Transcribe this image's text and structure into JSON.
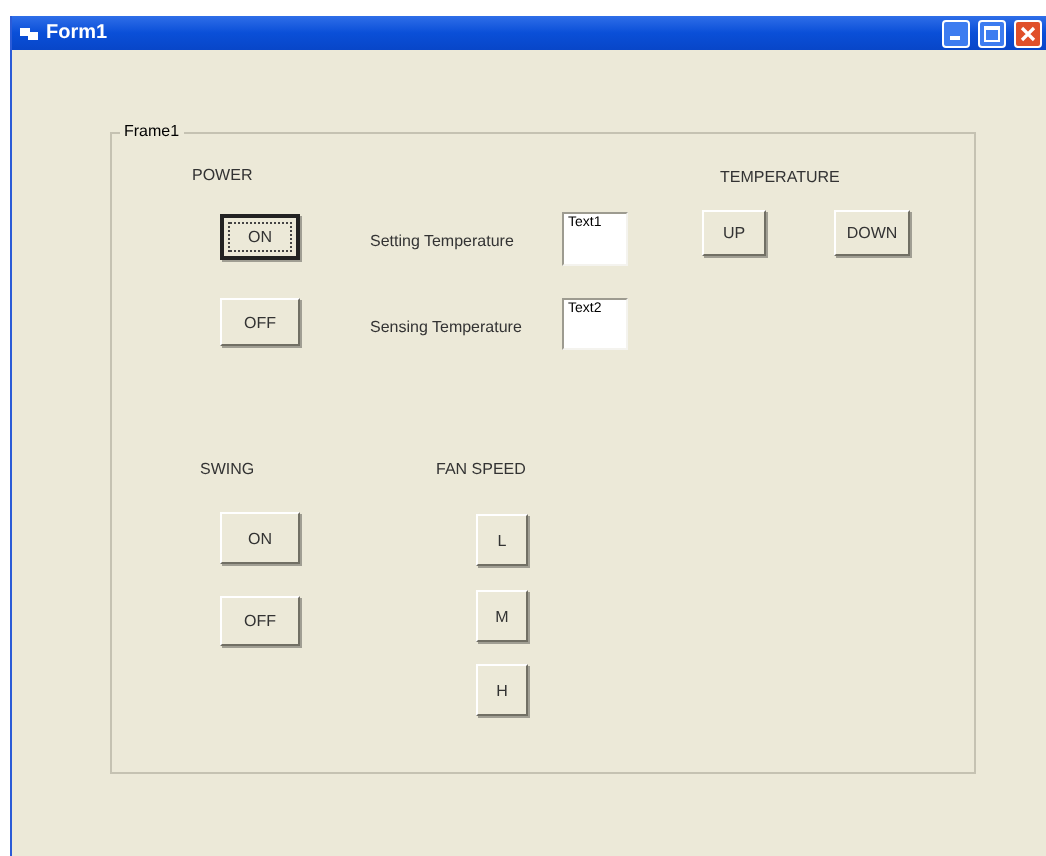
{
  "window": {
    "title": "Form1"
  },
  "frame": {
    "title": "Frame1"
  },
  "power": {
    "label": "POWER",
    "buttons": [
      {
        "label": "ON",
        "focused": true
      },
      {
        "label": "OFF",
        "focused": false
      }
    ]
  },
  "fields": [
    {
      "label": "Setting Temperature",
      "value": "Text1"
    },
    {
      "label": "Sensing Temperature",
      "value": "Text2"
    }
  ],
  "temperature": {
    "label": "TEMPERATURE",
    "buttons": [
      {
        "label": "UP",
        "focused": false
      },
      {
        "label": "DOWN",
        "focused": false
      }
    ]
  },
  "swing": {
    "label": "SWING",
    "buttons": [
      {
        "label": "ON",
        "focused": false
      },
      {
        "label": "OFF",
        "focused": false
      }
    ]
  },
  "fan_speed": {
    "label": "FAN SPEED",
    "buttons": [
      {
        "label": "L",
        "focused": false
      },
      {
        "label": "M",
        "focused": false
      },
      {
        "label": "H",
        "focused": false
      }
    ]
  }
}
